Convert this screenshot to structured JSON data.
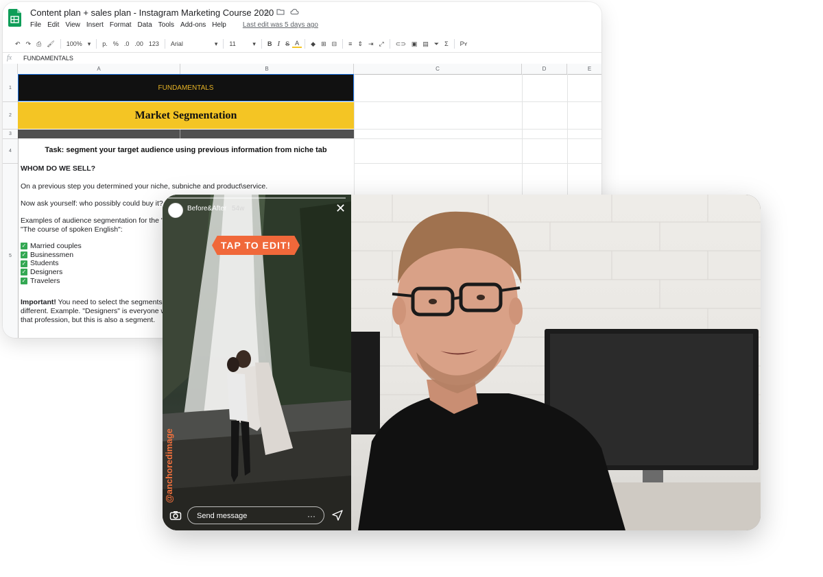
{
  "sheet": {
    "doc_title": "Content plan + sales plan - Instagram Marketing Course 2020",
    "menu": [
      "File",
      "Edit",
      "View",
      "Insert",
      "Format",
      "Data",
      "Tools",
      "Add-ons",
      "Help"
    ],
    "last_edit": "Last edit was 5 days ago",
    "toolbar": {
      "zoom": "100%",
      "currency": "p.",
      "percent": "%",
      "dec_less": ".0",
      "dec_more": ".00",
      "number_format": "123",
      "font": "Arial",
      "font_size": "11",
      "bold": "B",
      "italic": "I",
      "strike": "S",
      "text_color": "A",
      "sigma": "Σ"
    },
    "formula_value": "FUNDAMENTALS",
    "columns": [
      "A",
      "B",
      "C",
      "D",
      "E"
    ],
    "rows": [
      "1",
      "2",
      "3",
      "4",
      "5"
    ],
    "cells": {
      "fundamentals": "FUNDAMENTALS",
      "market_segmentation": "Market Segmentation",
      "task": "Task: segment your target audience using previous information from niche tab",
      "who_heading": "WHOM DO WE SELL?",
      "line1": "On a previous step you determined your niche, subniche and product\\service.",
      "line2": "Now ask yourself: who possibly could buy it? Di",
      "line3a": "Examples of audience segmentation for the \"",
      "line3b": "\"The course of spoken English\":",
      "segments": [
        "Married couples",
        "Businessmen",
        "Students",
        "Designers",
        "Travelers"
      ],
      "important_label": "Important!",
      "important_text": " You need to select the segments",
      "important_line2": "different. Example. \"Designers\" is everyone w",
      "important_line3": "that profession, but this is also a segment."
    }
  },
  "story": {
    "username": "Before&After",
    "time": "54w",
    "sticker": "TAP TO EDIT!",
    "handle": "@anchoredimage",
    "message_placeholder": "Send message",
    "more": "···"
  },
  "colors": {
    "sheets_green": "#0f9d58",
    "yellow_band": "#f4c524",
    "dark_band": "#111111",
    "fundamentals_text": "#e6b325",
    "sticker_orange": "#f0683a",
    "checkbox_green": "#34a853"
  }
}
